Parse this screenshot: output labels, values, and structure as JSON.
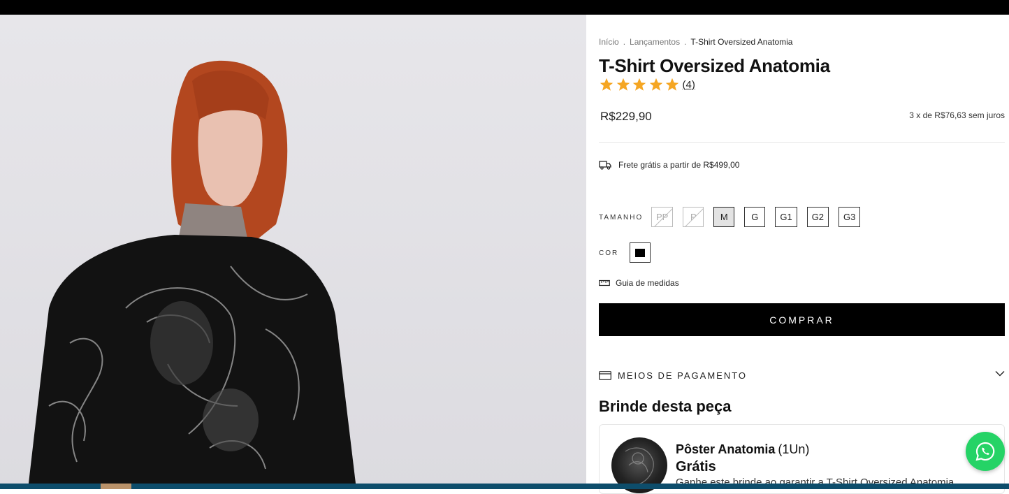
{
  "breadcrumb": {
    "home": "Início",
    "category": "Lançamentos",
    "current": "T-Shirt Oversized Anatomia",
    "separator": "."
  },
  "product": {
    "title": "T-Shirt Oversized Anatomia",
    "rating": {
      "stars": 5,
      "count_label": "(4)"
    },
    "price": "R$229,90",
    "installments": "3 x de R$76,63 sem juros",
    "shipping": "Frete grátis a partir de R$499,00"
  },
  "options": {
    "size_label": "TAMANHO",
    "sizes": [
      {
        "label": "PP",
        "state": "disabled"
      },
      {
        "label": "P",
        "state": "disabled"
      },
      {
        "label": "M",
        "state": "selected"
      },
      {
        "label": "G",
        "state": "available"
      },
      {
        "label": "G1",
        "state": "available"
      },
      {
        "label": "G2",
        "state": "available"
      },
      {
        "label": "G3",
        "state": "available"
      }
    ],
    "color_label": "COR",
    "color_value": "#000000",
    "size_guide": "Guia de medidas"
  },
  "actions": {
    "buy_label": "COMPRAR",
    "payment_label": "MEIOS DE PAGAMENTO"
  },
  "gift": {
    "section_title": "Brinde desta peça",
    "name": "Pôster Anatomia",
    "qty": "(1Un)",
    "price": "Grátis",
    "description": "Ganhe este brinde ao garantir a T-Shirt Oversized Anatomia"
  },
  "colors": {
    "star": "#f5a623",
    "buy_bg": "#000000",
    "whatsapp": "#25d366"
  },
  "icons": [
    "truck-icon",
    "ruler-icon",
    "credit-card-icon",
    "chevron-down-icon",
    "whatsapp-icon",
    "star-icon"
  ]
}
